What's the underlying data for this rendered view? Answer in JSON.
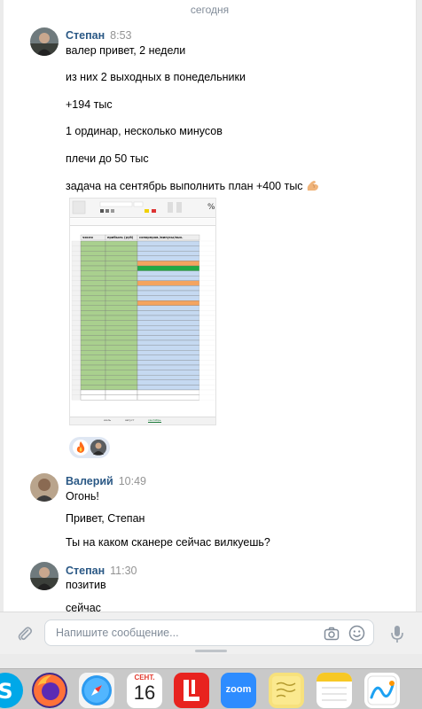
{
  "chat": {
    "date_separator": "сегодня",
    "messages": [
      {
        "author": "Степан",
        "time": "8:53",
        "lines": [
          "валер привет, 2 недели",
          "из них 2 выходных в понедельники",
          "+194 тыс",
          "1 ординар, несколько минусов",
          "плечи до 50 тыс",
          "задача на сентябрь выполнить план +400 тыс"
        ],
        "emoji_icon": "flexed-biceps-icon"
      },
      {
        "author": "Валерий",
        "time": "10:49",
        "lines": [
          "Огонь!",
          "Привет, Степан",
          "Ты на каком сканере сейчас вилкуешь?"
        ]
      },
      {
        "author": "Степан",
        "time": "11:30",
        "lines": [
          "позитив",
          "сейчас"
        ]
      }
    ],
    "reactions": [
      "fire-icon",
      "avatar-reaction-icon"
    ]
  },
  "spreadsheet": {
    "column_headers": [
      "число",
      "прибыль (руб)",
      "сопорправ./минусы/вых."
    ],
    "tabs": [
      "июль",
      "август",
      "сентябрь"
    ],
    "active_tab": "сентябрь"
  },
  "composer": {
    "placeholder": "Напишите сообщение...",
    "icons": [
      "paperclip-icon",
      "camera-icon",
      "smile-icon",
      "microphone-icon"
    ]
  },
  "dock": {
    "calendar_month": "СЕНТ.",
    "calendar_day": "16",
    "zoom_label": "zoom"
  },
  "colors": {
    "link_name": "#2a5885",
    "sheet_green": "#a9d08e",
    "sheet_blue": "#c5d9f1",
    "sheet_orange": "#f4a460",
    "sheet_bright_green": "#22aa44"
  }
}
